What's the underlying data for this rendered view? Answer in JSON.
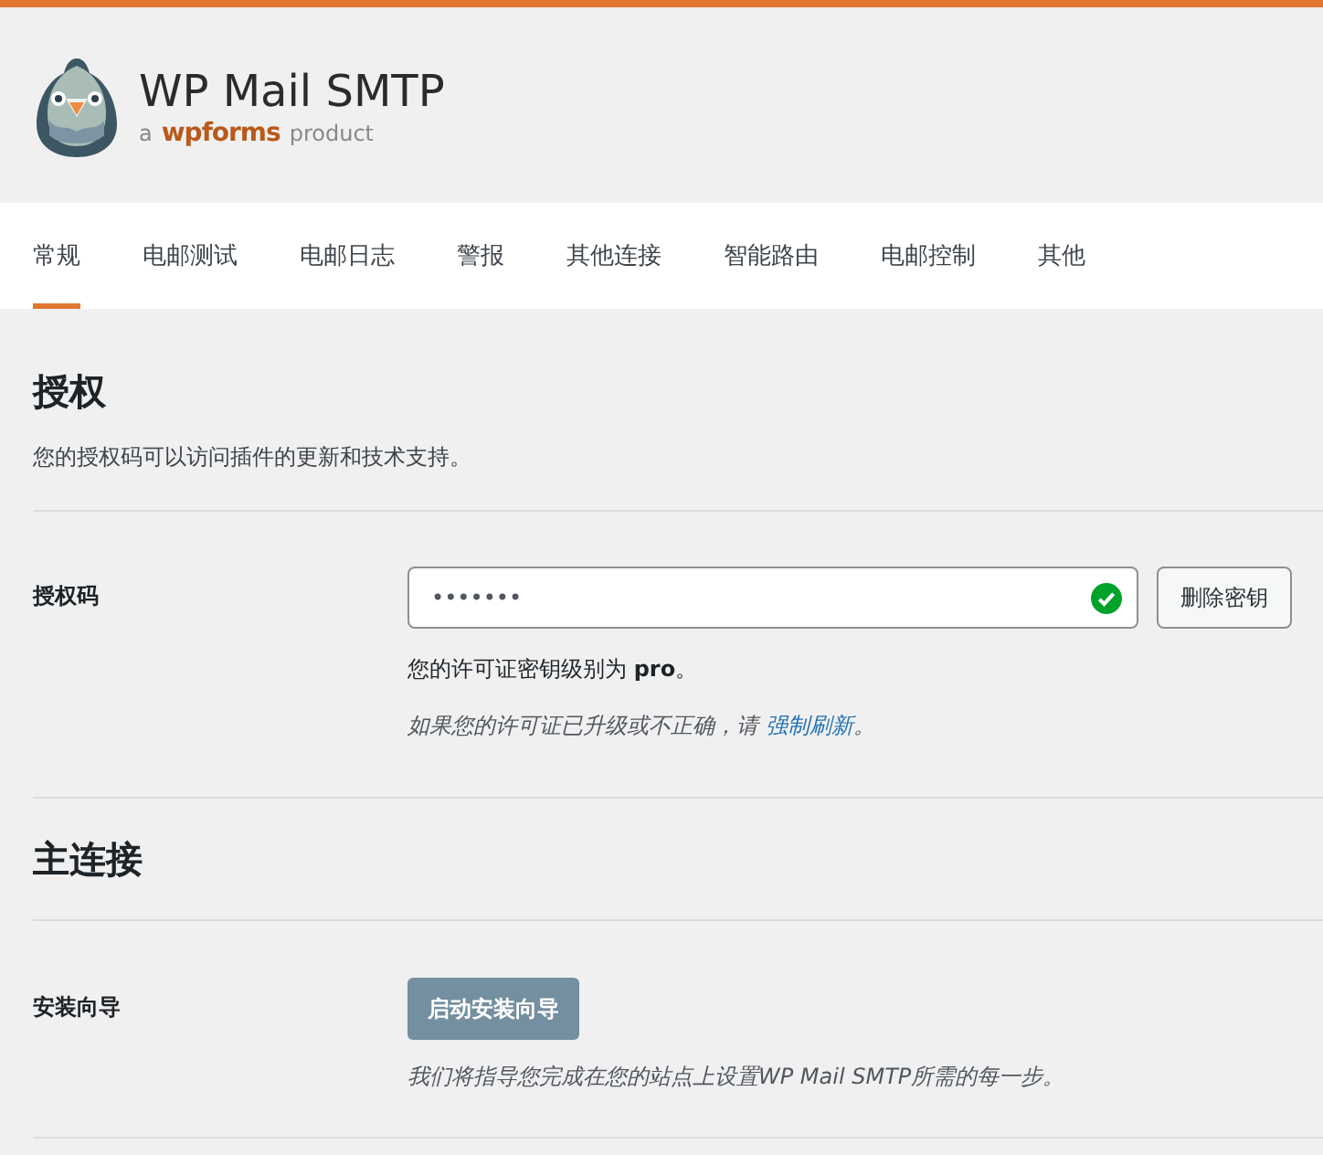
{
  "header": {
    "title": "WP Mail SMTP",
    "tagline_prefix": "a",
    "brand": "wpforms",
    "tagline_suffix": "product"
  },
  "tabs": [
    {
      "label": "常规",
      "selected": true
    },
    {
      "label": "电邮测试",
      "selected": false
    },
    {
      "label": "电邮日志",
      "selected": false
    },
    {
      "label": "警报",
      "selected": false
    },
    {
      "label": "其他连接",
      "selected": false
    },
    {
      "label": "智能路由",
      "selected": false
    },
    {
      "label": "电邮控制",
      "selected": false
    },
    {
      "label": "其他",
      "selected": false
    }
  ],
  "license": {
    "heading": "授权",
    "description": "您的授权码可以访问插件的更新和技术支持。",
    "label": "授权码",
    "value": "•••••••",
    "valid": true,
    "button": "删除密钥",
    "level_text": "您的许可证密钥级别为 **pro**。",
    "hint_prefix": "如果您的许可证已升级或不正确，请 ",
    "hint_link": "强制刷新",
    "hint_suffix": "。"
  },
  "main_connection": {
    "heading": "主连接",
    "label": "安装向导",
    "button": "启动安装向导",
    "description": "我们将指导您完成在您的站点上设置WP Mail SMTP所需的每一步。"
  }
}
